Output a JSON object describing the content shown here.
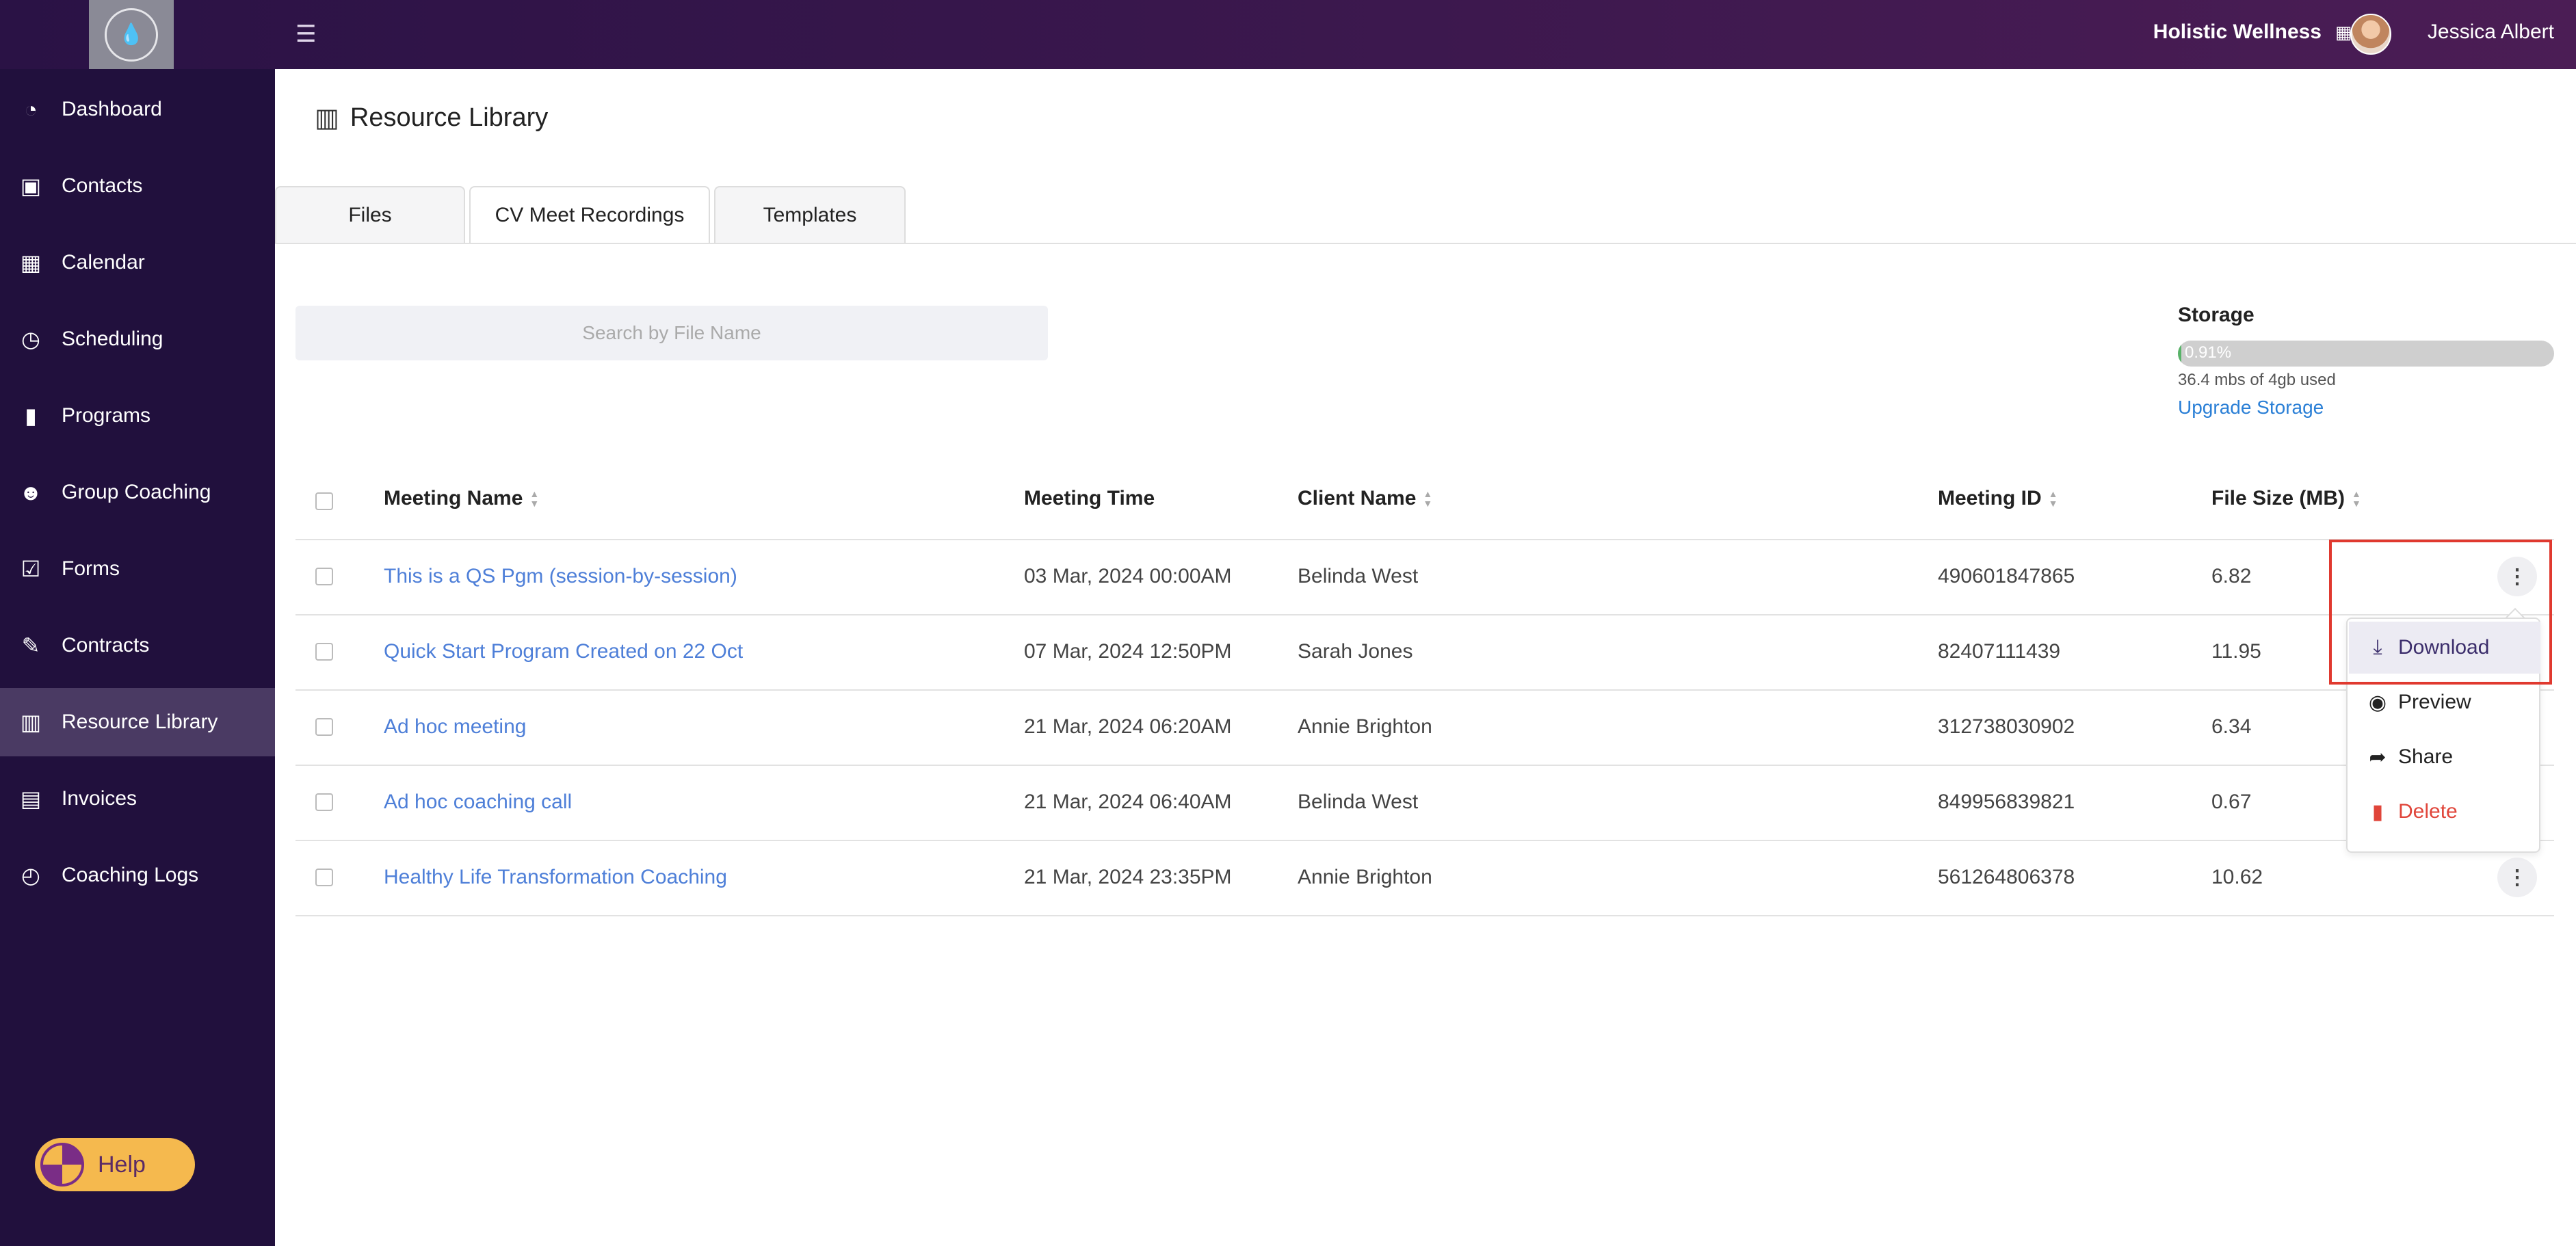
{
  "header": {
    "menu_icon": "hamburger-icon",
    "org_name": "Holistic Wellness",
    "org_icon": "briefcase-icon",
    "user_name": "Jessica Albert"
  },
  "sidebar": {
    "items": [
      {
        "label": "Dashboard",
        "icon": "gauge-icon",
        "glyph": "◔"
      },
      {
        "label": "Contacts",
        "icon": "contact-card-icon",
        "glyph": "▣"
      },
      {
        "label": "Calendar",
        "icon": "calendar-icon",
        "glyph": "▦"
      },
      {
        "label": "Scheduling",
        "icon": "calendar-clock-icon",
        "glyph": "◷"
      },
      {
        "label": "Programs",
        "icon": "book-icon",
        "glyph": "▮"
      },
      {
        "label": "Group Coaching",
        "icon": "users-icon",
        "glyph": "☻"
      },
      {
        "label": "Forms",
        "icon": "checklist-icon",
        "glyph": "☑"
      },
      {
        "label": "Contracts",
        "icon": "signature-icon",
        "glyph": "✎"
      },
      {
        "label": "Resource Library",
        "icon": "books-icon",
        "glyph": "▥"
      },
      {
        "label": "Invoices",
        "icon": "invoice-icon",
        "glyph": "▤"
      },
      {
        "label": "Coaching Logs",
        "icon": "clock-icon",
        "glyph": "◴"
      }
    ],
    "active_index": 8,
    "help_label": "Help"
  },
  "page": {
    "title": "Resource Library",
    "tabs": [
      "Files",
      "CV Meet Recordings",
      "Templates"
    ],
    "active_tab": 1,
    "search_placeholder": "Search by File Name"
  },
  "storage": {
    "title": "Storage",
    "percent_label": "0.91%",
    "percent_value": 0.91,
    "used_text": "36.4 mbs of 4gb used",
    "upgrade_label": "Upgrade Storage",
    "fill_color": "#58b368"
  },
  "table": {
    "columns": [
      "Meeting Name",
      "Meeting Time",
      "Client Name",
      "Meeting ID",
      "File Size (MB)"
    ],
    "rows": [
      {
        "name": "This is a QS Pgm (session-by-session)",
        "time": "03 Mar, 2024 00:00AM",
        "client": "Belinda West",
        "id": "490601847865",
        "size": "6.82"
      },
      {
        "name": "Quick Start Program Created on 22 Oct",
        "time": "07 Mar, 2024 12:50PM",
        "client": "Sarah Jones",
        "id": "82407111439",
        "size": "11.95"
      },
      {
        "name": "Ad hoc meeting",
        "time": "21 Mar, 2024 06:20AM",
        "client": "Annie Brighton",
        "id": "312738030902",
        "size": "6.34"
      },
      {
        "name": "Ad hoc coaching call",
        "time": "21 Mar, 2024 06:40AM",
        "client": "Belinda West",
        "id": "849956839821",
        "size": "0.67"
      },
      {
        "name": "Healthy Life Transformation Coaching",
        "time": "21 Mar, 2024 23:35PM",
        "client": "Annie Brighton",
        "id": "561264806378",
        "size": "10.62"
      }
    ]
  },
  "dropdown": {
    "items": [
      {
        "label": "Download",
        "icon": "download-icon"
      },
      {
        "label": "Preview",
        "icon": "eye-icon"
      },
      {
        "label": "Share",
        "icon": "share-icon"
      },
      {
        "label": "Delete",
        "icon": "trash-icon"
      }
    ],
    "highlight_color": "#e0392f"
  }
}
